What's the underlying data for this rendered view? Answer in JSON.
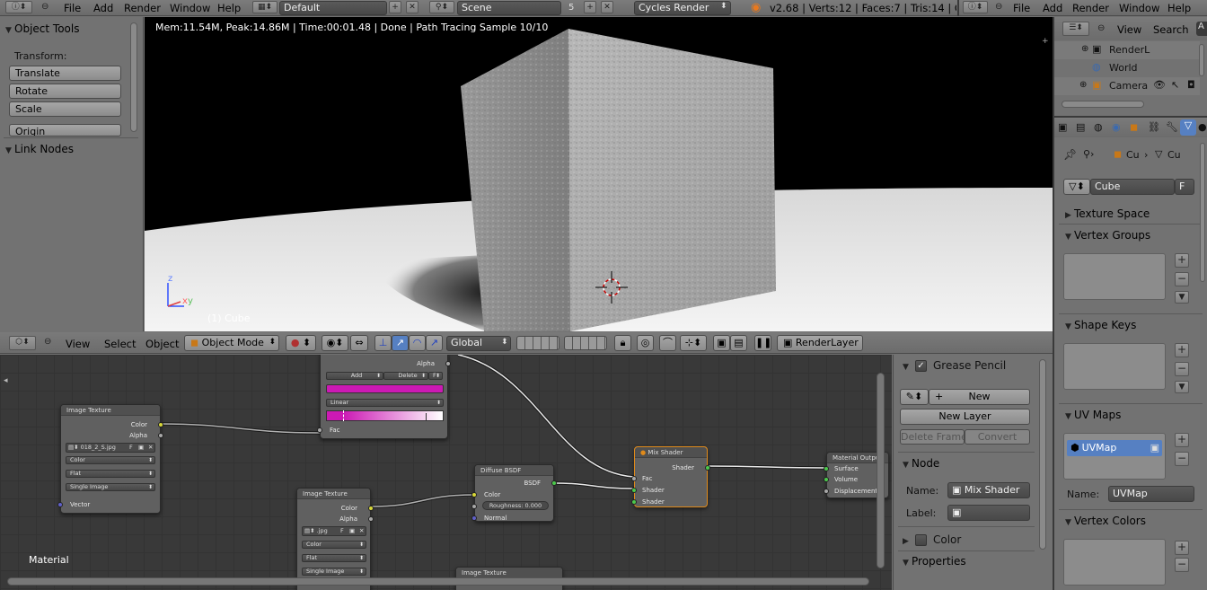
{
  "left_header": {
    "menus": [
      "File",
      "Add",
      "Render",
      "Window",
      "Help"
    ],
    "screen_layout": "Default",
    "scene": "Scene",
    "scene_users": "5",
    "render_engine": "Cycles Render",
    "stats": "v2.68 | Verts:12 | Faces:7 | Tris:14 | Ob"
  },
  "right_header": {
    "menus": [
      "File",
      "Add",
      "Render",
      "Window",
      "Help"
    ]
  },
  "tool_shelf": {
    "object_tools_title": "Object Tools",
    "transform_label": "Transform:",
    "translate": "Translate",
    "rotate": "Rotate",
    "scale": "Scale",
    "origin": "Origin",
    "link_nodes_title": "Link Nodes"
  },
  "viewport": {
    "render_info": "Mem:11.54M, Peak:14.86M | Time:00:01.48 | Done | Path Tracing Sample 10/10",
    "object_label": "(1) Cube",
    "axis_z": "z",
    "axis_x": "x",
    "axis_y": "y"
  },
  "view3d_header": {
    "view": "View",
    "select": "Select",
    "object": "Object",
    "mode": "Object Mode",
    "orientation": "Global",
    "render_layer": "RenderLayer"
  },
  "outliner": {
    "view": "View",
    "search": "Search",
    "items": [
      "RenderL",
      "World",
      "Camera"
    ]
  },
  "properties": {
    "breadcrumb_object": "Cu",
    "breadcrumb_mesh": "Cu",
    "mesh_name": "Cube",
    "fake_user": "F",
    "texture_space": "Texture Space",
    "vertex_groups": "Vertex Groups",
    "shape_keys": "Shape Keys",
    "uv_maps": "UV Maps",
    "uv_map_item": "UVMap",
    "name_label": "Name:",
    "uv_map_name": "UVMap",
    "vertex_colors": "Vertex Colors"
  },
  "node_editor": {
    "material_label": "Material",
    "image_texture_1": {
      "title": "Image Texture",
      "out_color": "Color",
      "out_alpha": "Alpha",
      "image": "018_2_S.jpg",
      "fake": "F",
      "color_space": "Color",
      "projection": "Flat",
      "source": "Single Image",
      "in_vector": "Vector"
    },
    "color_ramp": {
      "out_alpha": "Alpha",
      "add": "Add",
      "delete": "Delete",
      "flip": "F",
      "interpolation": "Linear",
      "in_fac": "Fac",
      "color_stop": "#cc19b4"
    },
    "image_texture_2": {
      "title": "Image Texture",
      "out_color": "Color",
      "out_alpha": "Alpha",
      "image": ".jpg",
      "fake": "F",
      "color_space": "Color",
      "projection": "Flat",
      "source": "Single Image"
    },
    "diffuse": {
      "title": "Diffuse BSDF",
      "out_bsdf": "BSDF",
      "in_color": "Color",
      "roughness": "Roughness: 0.000",
      "in_normal": "Normal"
    },
    "mix_shader": {
      "title": "Mix Shader",
      "out_shader": "Shader",
      "in_fac": "Fac",
      "in_shader1": "Shader",
      "in_shader2": "Shader"
    },
    "material_output": {
      "title": "Material Outpu",
      "in_surface": "Surface",
      "in_volume": "Volume",
      "in_displacement": "Displacement"
    },
    "image_texture_3": {
      "title": "Image Texture"
    }
  },
  "node_sidebar": {
    "grease_pencil": "Grease Pencil",
    "new": "New",
    "new_layer": "New Layer",
    "delete_frame": "Delete Frame",
    "convert": "Convert",
    "node_title": "Node",
    "name_label": "Name:",
    "node_name": "Mix Shader",
    "label_label": "Label:",
    "color": "Color",
    "properties": "Properties"
  }
}
